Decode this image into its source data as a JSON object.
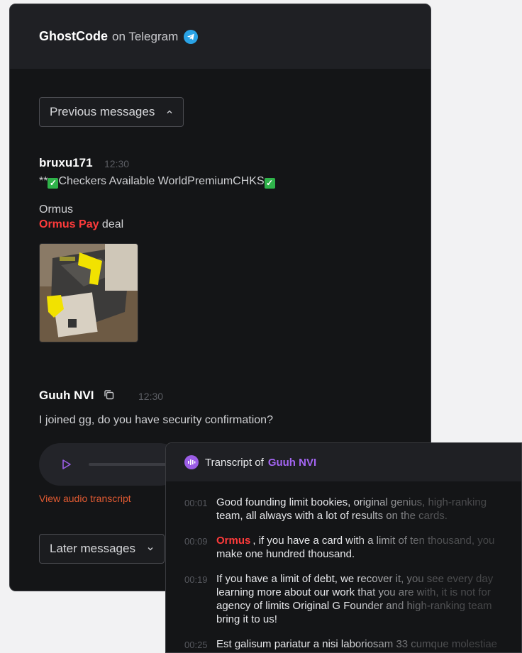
{
  "header": {
    "brand": "GhostCode",
    "platform": "on Telegram",
    "icon": "telegram-icon"
  },
  "previous_button": {
    "label": "Previous messages",
    "icon": "chevron-up-icon"
  },
  "later_button": {
    "label": "Later messages",
    "icon": "chevron-down-icon"
  },
  "messages": [
    {
      "author": "bruxu171",
      "time": "12:30",
      "line1_prefix": "**",
      "line1_text": "Checkers Available WorldPremiumCHKS",
      "line2": "Ormus",
      "line3_highlight": "Ormus Pay",
      "line3_rest": " deal",
      "has_photo": true
    },
    {
      "author": "Guuh NVI",
      "time": "12:30",
      "text": "I joined gg, do you have security confirmation?",
      "copy_icon": "copy-icon"
    }
  ],
  "audio": {
    "play_icon": "play-icon",
    "link_label": "View audio transcript"
  },
  "transcript": {
    "title": "Transcript of",
    "speaker": "Guuh NVI",
    "icon": "waveform-icon",
    "segments": [
      {
        "time": "00:01",
        "text": "Good founding limit bookies, original genius, high-ranking team, all always with a lot of results on the cards."
      },
      {
        "time": "00:09",
        "highlight": "Ormus",
        "text": ", if you have a card with a limit of ten thousand, you make one hundred thousand."
      },
      {
        "time": "00:19",
        "text": "If you have a limit of debt, we recover it, you see every day learning more about our work that you are with, it is not for agency of limits Original G Founder and high-ranking team bring it to us!"
      },
      {
        "time": "00:25",
        "text": "Est galisum pariatur a nisi laboriosam 33 cumque molestiae"
      }
    ]
  },
  "colors": {
    "accent_red": "#ff3b3b",
    "telegram_blue": "#2aa3e6",
    "transcript_purple": "#a365f2",
    "link_orange": "#e05a32"
  }
}
